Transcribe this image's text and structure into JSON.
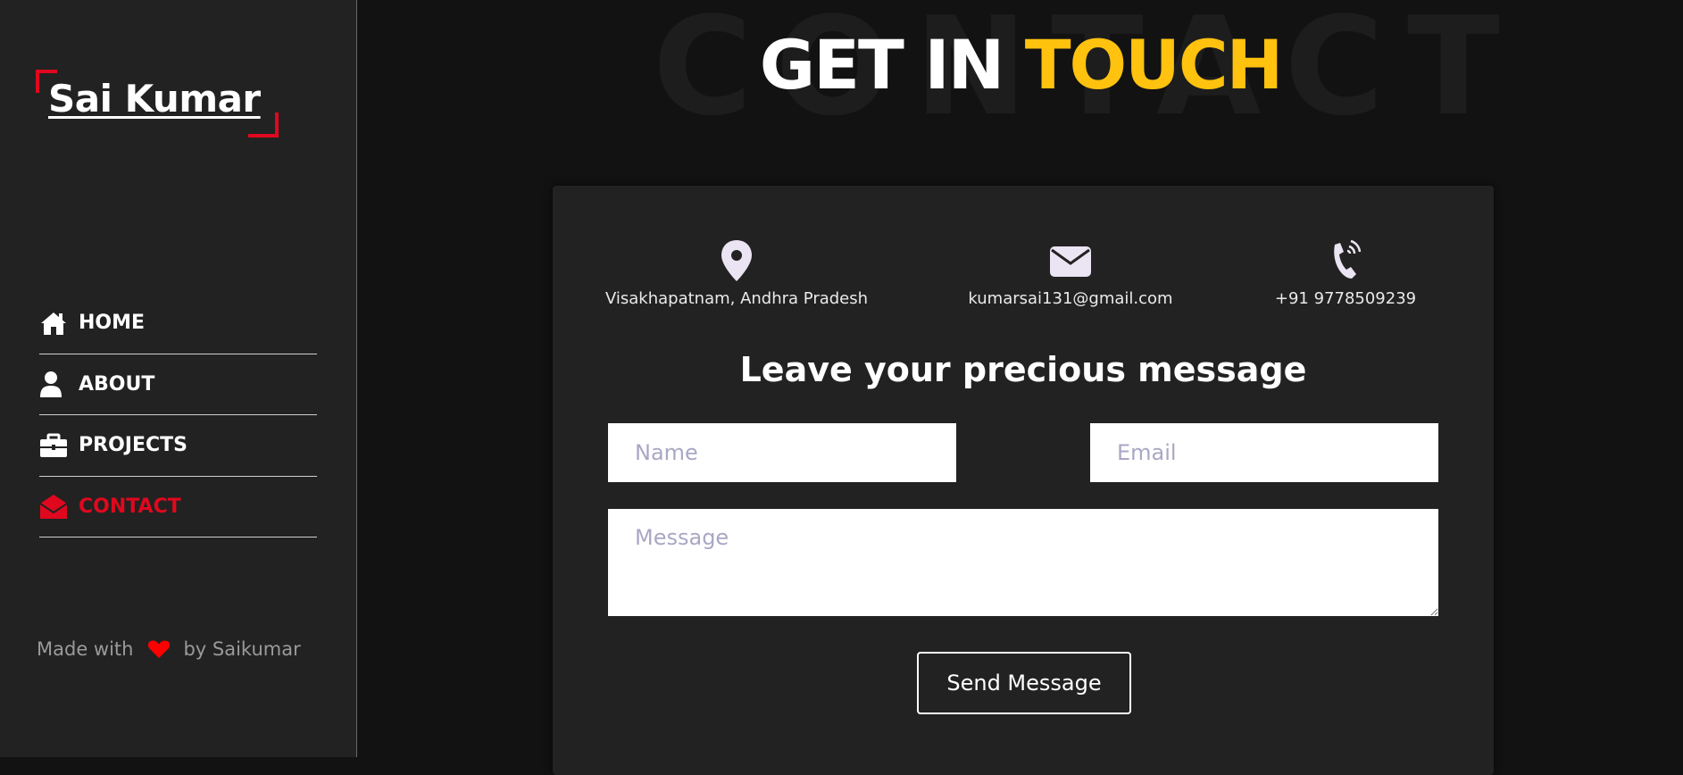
{
  "sidebar": {
    "logo": "Sai Kumar",
    "nav": [
      {
        "label": "HOME",
        "icon": "home-icon"
      },
      {
        "label": "ABOUT",
        "icon": "user-icon"
      },
      {
        "label": "PROJECTS",
        "icon": "briefcase-icon"
      },
      {
        "label": "CONTACT",
        "icon": "envelope-open-icon",
        "active": true
      }
    ],
    "footer": {
      "prefix": "Made with",
      "suffix": "by Saikumar",
      "icon": "heart-icon"
    }
  },
  "main": {
    "background_title": "CONTACT",
    "title_part1": "GET IN",
    "title_part2": "TOUCH",
    "info": {
      "location": "Visakhapatnam, Andhra Pradesh",
      "email": "kumarsai131@gmail.com",
      "phone": "+91 9778509239"
    },
    "form": {
      "heading": "Leave your precious message",
      "name_placeholder": "Name",
      "email_placeholder": "Email",
      "message_placeholder": "Message",
      "send_label": "Send Message"
    }
  },
  "colors": {
    "accent_red": "#e0081e",
    "accent_yellow": "#ffc20e",
    "sidebar_bg": "#222222",
    "page_bg": "#121212",
    "card_bg": "#222222"
  }
}
